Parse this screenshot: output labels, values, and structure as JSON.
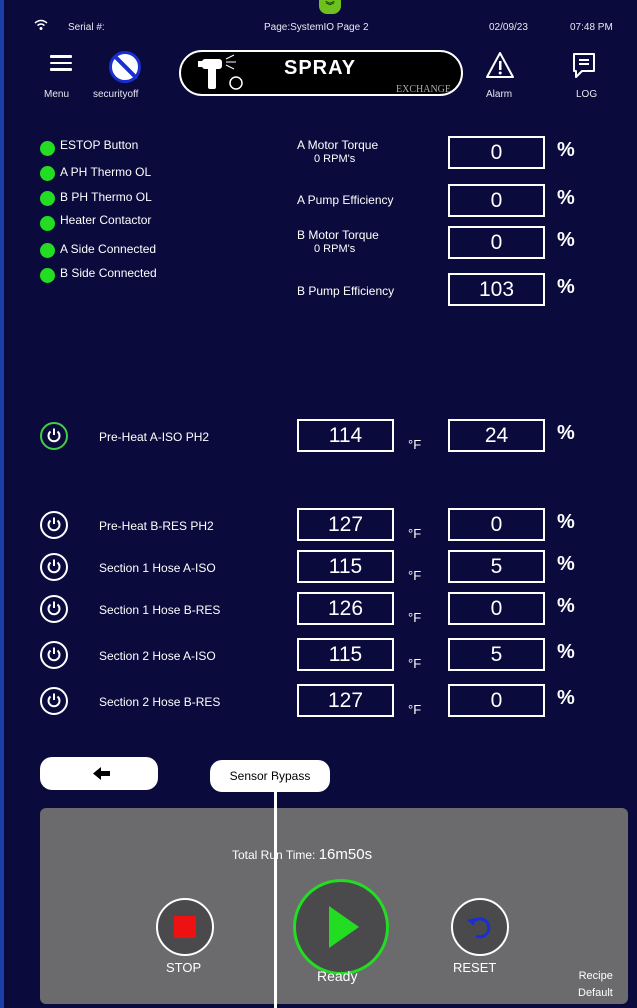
{
  "status_bar": {
    "serial_label": "Serial #:",
    "page": "Page:SystemIO Page 2",
    "date": "02/09/23",
    "time": "07:48 PM"
  },
  "header": {
    "menu_label": "Menu",
    "security_label": "securityoff",
    "logo_text": "SPRAY",
    "logo_sub": "EXCHANGE",
    "alarm_label": "Alarm",
    "log_label": "LOG"
  },
  "indicators": [
    {
      "label": "ESTOP Button",
      "color": "#22dd22"
    },
    {
      "label": "A PH Thermo OL",
      "color": "#22dd22"
    },
    {
      "label": "B PH Thermo OL",
      "color": "#22dd22"
    },
    {
      "label": "Heater Contactor",
      "color": "#22dd22"
    },
    {
      "label": "A Side Connected",
      "color": "#22dd22"
    },
    {
      "label": "B Side Connected",
      "color": "#22dd22"
    }
  ],
  "motors": [
    {
      "label": "A Motor Torque",
      "sub": "0   RPM's",
      "value": "0",
      "unit": "%"
    },
    {
      "label": "A Pump Efficiency",
      "value": "0",
      "unit": "%"
    },
    {
      "label": "B Motor Torque",
      "sub": "0   RPM's",
      "value": "0",
      "unit": "%"
    },
    {
      "label": "B Pump Efficiency",
      "value": "103",
      "unit": "%"
    }
  ],
  "heaters": [
    {
      "label": "Pre-Heat A-ISO PH2",
      "temp": "114",
      "temp_unit": "°F",
      "pct": "24",
      "pct_unit": "%",
      "active": true
    },
    {
      "label": "Pre-Heat B-RES PH2",
      "temp": "127",
      "temp_unit": "°F",
      "pct": "0",
      "pct_unit": "%",
      "active": false
    },
    {
      "label": "Section 1 Hose A-ISO",
      "temp": "115",
      "temp_unit": "°F",
      "pct": "5",
      "pct_unit": "%",
      "active": false
    },
    {
      "label": "Section 1 Hose B-RES",
      "temp": "126",
      "temp_unit": "°F",
      "pct": "0",
      "pct_unit": "%",
      "active": false
    },
    {
      "label": "Section 2 Hose A-ISO",
      "temp": "115",
      "temp_unit": "°F",
      "pct": "5",
      "pct_unit": "%",
      "active": false
    },
    {
      "label": "Section 2 Hose B-RES",
      "temp": "127",
      "temp_unit": "°F",
      "pct": "0",
      "pct_unit": "%",
      "active": false
    }
  ],
  "buttons": {
    "sensor_bypass": "Sensor Bypass"
  },
  "control_panel": {
    "run_time_label": "Total Run Time:",
    "run_time_value": "16m50s",
    "stop_label": "STOP",
    "ready_label": "Ready",
    "reset_label": "RESET",
    "recipe_label": "Recipe",
    "recipe_value": "Default"
  },
  "colors": {
    "background": "#0a0a3c",
    "indicator_ok": "#22dd22",
    "ready_accent": "#22dd22",
    "stop_red": "#ee1111",
    "reset_blue": "#1a2fd0"
  }
}
